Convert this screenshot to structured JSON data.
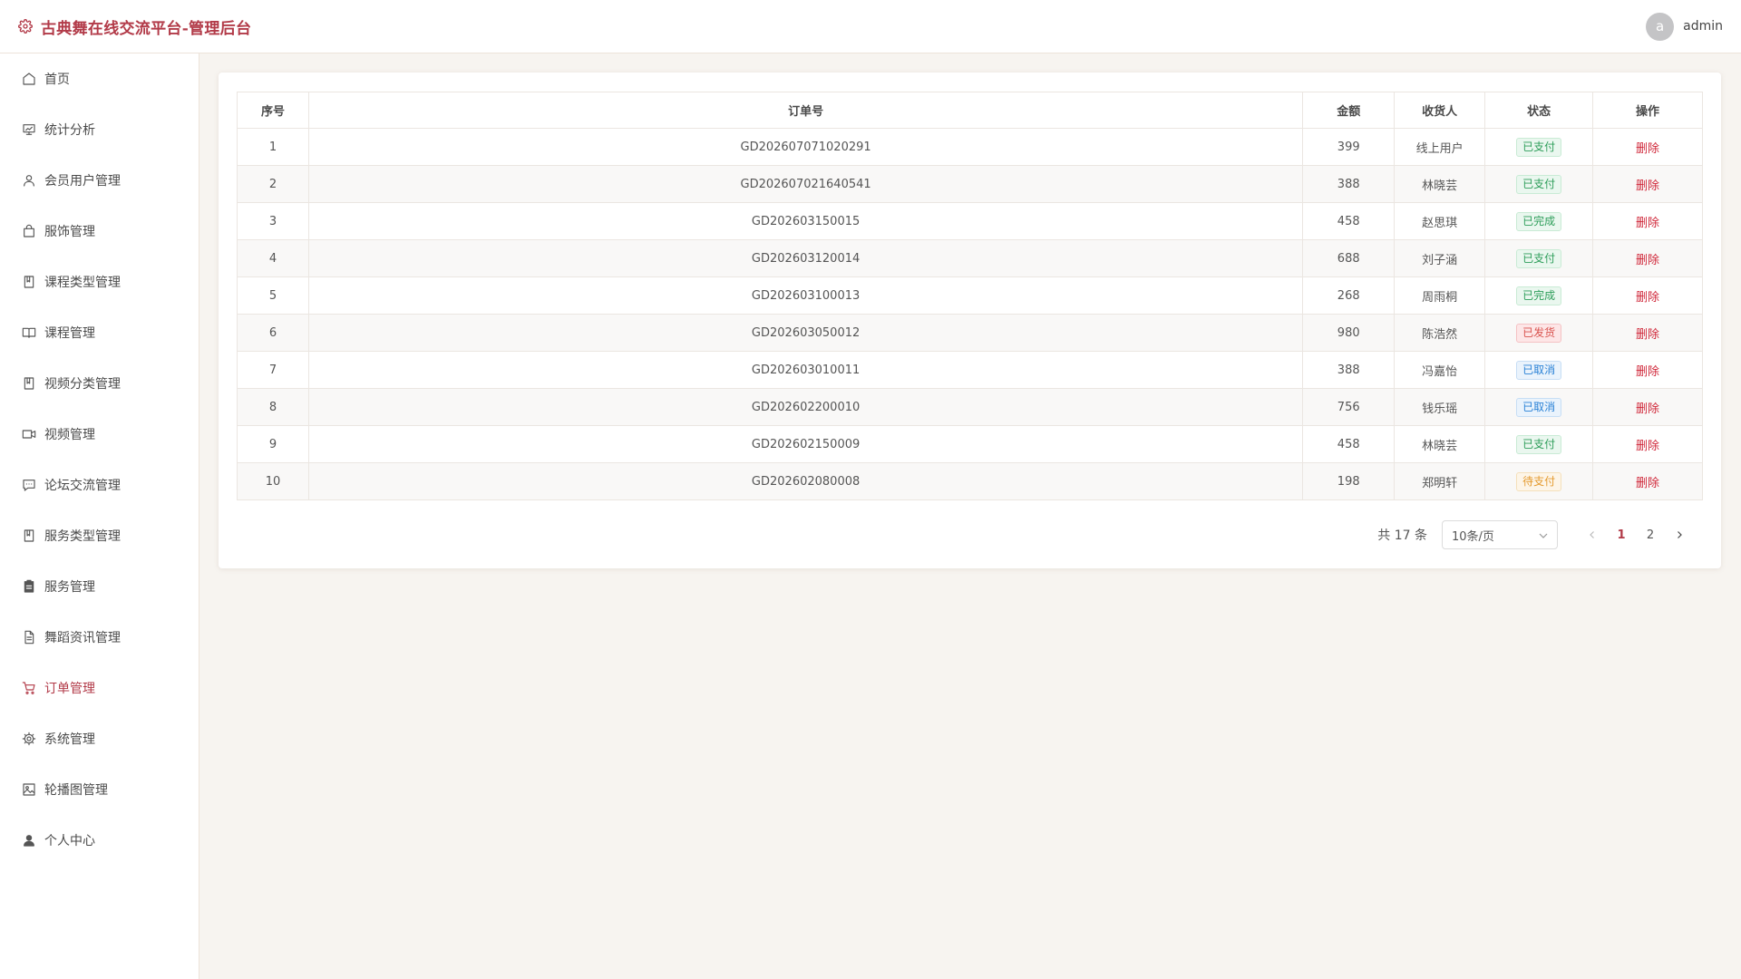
{
  "header": {
    "title": "古典舞在线交流平台-管理后台",
    "avatar_letter": "a",
    "username": "admin"
  },
  "sidebar": {
    "items": [
      {
        "label": "首页",
        "icon": "home-icon"
      },
      {
        "label": "统计分析",
        "icon": "presentation-chart-icon"
      },
      {
        "label": "会员用户管理",
        "icon": "user-outline-icon"
      },
      {
        "label": "服饰管理",
        "icon": "shopping-bag-icon"
      },
      {
        "label": "课程类型管理",
        "icon": "notebook-icon"
      },
      {
        "label": "课程管理",
        "icon": "open-book-icon"
      },
      {
        "label": "视频分类管理",
        "icon": "notebook-icon"
      },
      {
        "label": "视频管理",
        "icon": "video-camera-icon"
      },
      {
        "label": "论坛交流管理",
        "icon": "chat-icon"
      },
      {
        "label": "服务类型管理",
        "icon": "notebook-icon"
      },
      {
        "label": "服务管理",
        "icon": "clipboard-icon"
      },
      {
        "label": "舞蹈资讯管理",
        "icon": "document-icon"
      },
      {
        "label": "订单管理",
        "icon": "shopping-cart-icon",
        "active": true
      },
      {
        "label": "系统管理",
        "icon": "gear-icon"
      },
      {
        "label": "轮播图管理",
        "icon": "image-icon"
      },
      {
        "label": "个人中心",
        "icon": "user-filled-icon"
      }
    ]
  },
  "table": {
    "headers": [
      "序号",
      "订单号",
      "金额",
      "收货人",
      "状态",
      "操作"
    ],
    "rows": [
      {
        "idx": "1",
        "order": "GD202607071020291",
        "amount": "399",
        "receiver": "线上用户",
        "status": "已支付",
        "status_color": "green",
        "action": "删除"
      },
      {
        "idx": "2",
        "order": "GD202607021640541",
        "amount": "388",
        "receiver": "林晓芸",
        "status": "已支付",
        "status_color": "green",
        "action": "删除"
      },
      {
        "idx": "3",
        "order": "GD202603150015",
        "amount": "458",
        "receiver": "赵思琪",
        "status": "已完成",
        "status_color": "green",
        "action": "删除"
      },
      {
        "idx": "4",
        "order": "GD202603120014",
        "amount": "688",
        "receiver": "刘子涵",
        "status": "已支付",
        "status_color": "green",
        "action": "删除"
      },
      {
        "idx": "5",
        "order": "GD202603100013",
        "amount": "268",
        "receiver": "周雨桐",
        "status": "已完成",
        "status_color": "green",
        "action": "删除"
      },
      {
        "idx": "6",
        "order": "GD202603050012",
        "amount": "980",
        "receiver": "陈浩然",
        "status": "已发货",
        "status_color": "red",
        "action": "删除"
      },
      {
        "idx": "7",
        "order": "GD202603010011",
        "amount": "388",
        "receiver": "冯嘉怡",
        "status": "已取消",
        "status_color": "blue",
        "action": "删除"
      },
      {
        "idx": "8",
        "order": "GD202602200010",
        "amount": "756",
        "receiver": "钱乐瑶",
        "status": "已取消",
        "status_color": "blue",
        "action": "删除"
      },
      {
        "idx": "9",
        "order": "GD202602150009",
        "amount": "458",
        "receiver": "林晓芸",
        "status": "已支付",
        "status_color": "green",
        "action": "删除"
      },
      {
        "idx": "10",
        "order": "GD202602080008",
        "amount": "198",
        "receiver": "郑明轩",
        "status": "待支付",
        "status_color": "orange",
        "action": "删除"
      }
    ]
  },
  "pagination": {
    "total_text": "共 17 条",
    "page_size": "10条/页",
    "pages": [
      "1",
      "2"
    ],
    "current_page": "1"
  },
  "colors": {
    "accent": "#b23a48",
    "background": "#f7f4f0"
  }
}
